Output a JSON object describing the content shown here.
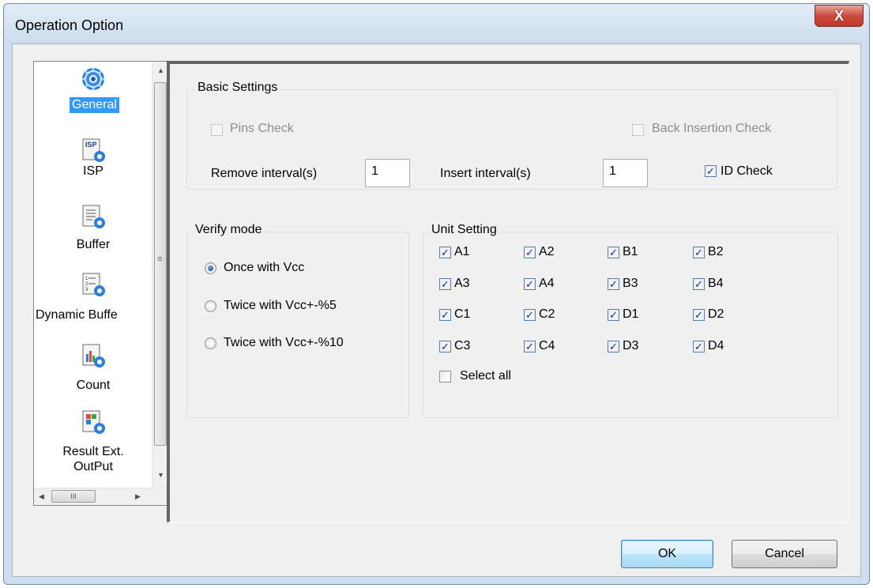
{
  "window": {
    "title": "Operation Option",
    "close_glyph": "X"
  },
  "nav": {
    "items": [
      {
        "label": "General",
        "icon": "gear-icon",
        "selected": true
      },
      {
        "label": "ISP",
        "icon": "isp-icon",
        "badge": "ISP"
      },
      {
        "label": "Buffer",
        "icon": "buffer-icon"
      },
      {
        "label": "Dynamic Buffe",
        "icon": "dynamic-buffer-icon"
      },
      {
        "label": "Count",
        "icon": "count-icon"
      },
      {
        "label": "Result Ext.",
        "label2": "OutPut",
        "icon": "result-output-icon"
      }
    ],
    "scroll_up": "▲",
    "scroll_down": "▼",
    "scroll_left": "◀",
    "scroll_right": "▶",
    "vgrip": "≡",
    "hgrip": "III"
  },
  "basic": {
    "title": "Basic Settings",
    "pins_check": "Pins Check",
    "back_insertion_check": "Back Insertion Check",
    "remove_interval_label": "Remove interval(s)",
    "remove_interval_value": "1",
    "insert_interval_label": "Insert interval(s)",
    "insert_interval_value": "1",
    "id_check": "ID Check"
  },
  "verify": {
    "title": "Verify mode",
    "options": [
      "Once with Vcc",
      "Twice with Vcc+-%5",
      "Twice with Vcc+-%10"
    ],
    "selected_index": 0
  },
  "units": {
    "title": "Unit Setting",
    "rows": [
      [
        "A1",
        "A2",
        "B1",
        "B2"
      ],
      [
        "A3",
        "A4",
        "B3",
        "B4"
      ],
      [
        "C1",
        "C2",
        "D1",
        "D2"
      ],
      [
        "C3",
        "C4",
        "D3",
        "D4"
      ]
    ],
    "select_all": "Select all"
  },
  "buttons": {
    "ok": "OK",
    "cancel": "Cancel"
  },
  "check_glyph": "✓"
}
